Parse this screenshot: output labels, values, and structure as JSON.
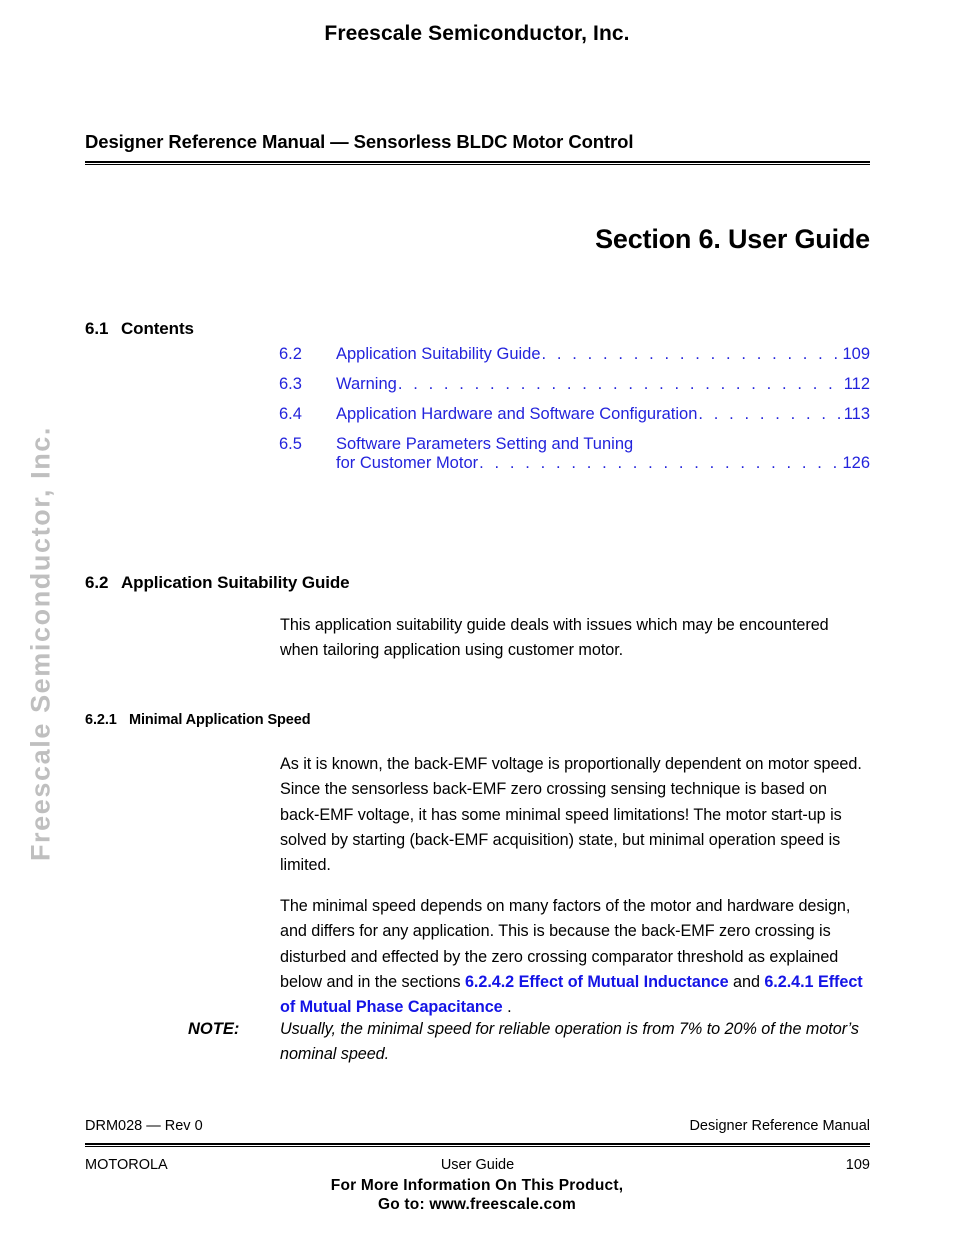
{
  "banner": {
    "text": "Freescale Semiconductor, Inc."
  },
  "watermark": {
    "text": "Freescale Semiconductor, Inc.",
    "color": "#bfbfbf"
  },
  "header": {
    "running_head": "Designer Reference Manual — Sensorless BLDC Motor Control",
    "section_title": "Section 6. User Guide"
  },
  "colors": {
    "link_blue": "#2323dc",
    "xref_blue": "#1414e6",
    "text_black": "#000000"
  },
  "contents_heading": {
    "number": "6.1",
    "label": "Contents"
  },
  "toc": {
    "entries": [
      {
        "number": "6.2",
        "label": "Application Suitability Guide",
        "page": "109",
        "continuation": ""
      },
      {
        "number": "6.3",
        "label": "Warning",
        "page": "112",
        "continuation": ""
      },
      {
        "number": "6.4",
        "label": "Application Hardware and Software Configuration",
        "page": "113",
        "continuation": ""
      },
      {
        "number": "6.5",
        "label": "Software Parameters Setting and Tuning",
        "page": "126",
        "continuation": "for Customer Motor"
      }
    ]
  },
  "suitability_heading": {
    "number": "6.2",
    "label": "Application Suitability Guide"
  },
  "intro_paragraph": "This application suitability guide deals with issues which may be encountered when tailoring application using customer motor.",
  "minspeed_heading": {
    "number": "6.2.1",
    "label": "Minimal Application Speed"
  },
  "paragraphs": {
    "back_emf": "As it is known, the back-EMF voltage is proportionally dependent on motor speed. Since the sensorless back-EMF zero crossing sensing technique is based on back-EMF voltage, it has some minimal speed limitations! The motor start-up is solved by starting (back-EMF acquisition) state, but minimal operation speed is limited.",
    "min_speed_prefix": "The minimal speed depends on many factors of the motor and hardware design, and differs for any application. This is because the back-EMF zero crossing is disturbed and effected by the zero crossing comparator threshold as explained below and in the sections ",
    "xref_1": "6.2.4.2 Effect of Mutual Inductance",
    "min_speed_middle": " and ",
    "xref_2": "6.2.4.1 Effect of Mutual Phase Capacitance",
    "min_speed_suffix": " ."
  },
  "note": {
    "label": "NOTE:",
    "text": "Usually, the minimal speed for reliable operation is from 7% to 20% of the motor’s nominal speed."
  },
  "footer": {
    "doc_id": "DRM028 — Rev 0",
    "manual_name": "Designer Reference Manual",
    "company": "MOTOROLA",
    "chapter": "User Guide",
    "page_number": "109",
    "cta_line1": "For More Information On This Product,",
    "cta_line2": "Go to: www.freescale.com"
  }
}
